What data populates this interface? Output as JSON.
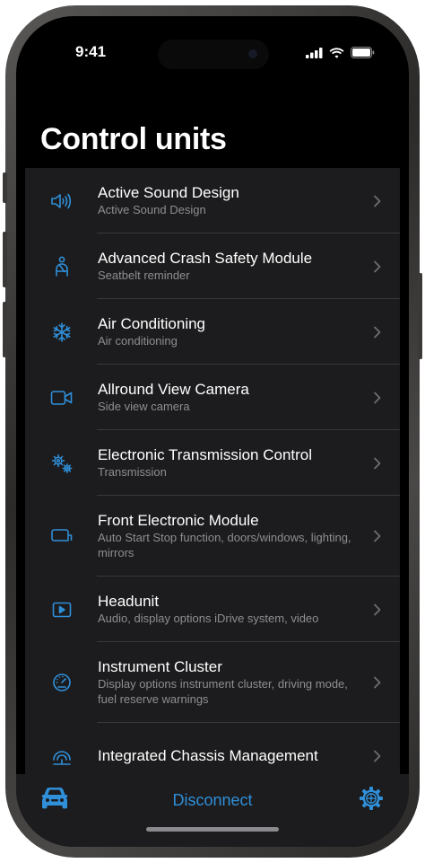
{
  "status_bar": {
    "time": "9:41"
  },
  "header": {
    "title": "Control units"
  },
  "colors": {
    "accent": "#2f8fd8",
    "background": "#000000",
    "cell": "#1c1c1e",
    "subtitle": "#8e8e93"
  },
  "control_units": [
    {
      "title": "Active Sound Design",
      "subtitle": "Active Sound Design",
      "icon": "speaker-icon"
    },
    {
      "title": "Advanced Crash Safety Module",
      "subtitle": "Seatbelt reminder",
      "icon": "seatbelt-icon"
    },
    {
      "title": "Air Conditioning",
      "subtitle": "Air conditioning",
      "icon": "snowflake-icon"
    },
    {
      "title": "Allround View Camera",
      "subtitle": "Side view camera",
      "icon": "video-camera-icon"
    },
    {
      "title": "Electronic Transmission Control",
      "subtitle": "Transmission",
      "icon": "gears-icon"
    },
    {
      "title": "Front Electronic Module",
      "subtitle": "Auto Start Stop function, doors/windows, lighting, mirrors",
      "icon": "side-mirror-icon"
    },
    {
      "title": "Headunit",
      "subtitle": "Audio, display options iDrive system, video",
      "icon": "play-screen-icon"
    },
    {
      "title": "Instrument Cluster",
      "subtitle": "Display options instrument cluster, driving mode, fuel reserve warnings",
      "icon": "gauge-icon"
    },
    {
      "title": "Integrated Chassis Management",
      "subtitle": "",
      "icon": "chassis-icon"
    }
  ],
  "tab_bar": {
    "left_icon": "car-icon",
    "disconnect_label": "Disconnect",
    "right_icon": "gear-icon"
  }
}
